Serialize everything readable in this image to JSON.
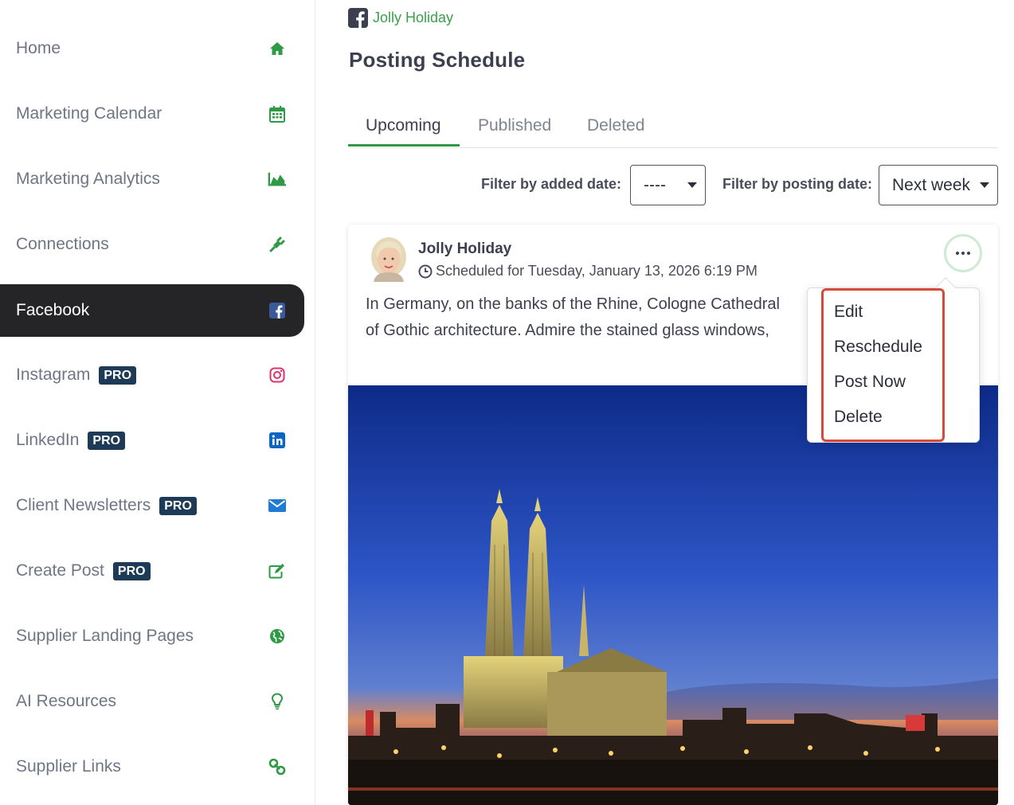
{
  "sidebar": {
    "items": [
      {
        "label": "Home",
        "icon": "home-icon",
        "pro": ""
      },
      {
        "label": "Marketing Calendar",
        "icon": "calendar-icon",
        "pro": ""
      },
      {
        "label": "Marketing Analytics",
        "icon": "area-chart-icon",
        "pro": ""
      },
      {
        "label": "Connections",
        "icon": "plug-icon",
        "pro": ""
      },
      {
        "label": "Facebook",
        "icon": "facebook-icon",
        "pro": ""
      },
      {
        "label": "Instagram",
        "icon": "instagram-icon",
        "pro": "PRO"
      },
      {
        "label": "LinkedIn",
        "icon": "linkedin-icon",
        "pro": "PRO"
      },
      {
        "label": "Client Newsletters",
        "icon": "envelope-icon",
        "pro": "PRO"
      },
      {
        "label": "Create Post",
        "icon": "edit-icon",
        "pro": "PRO"
      },
      {
        "label": "Supplier Landing Pages",
        "icon": "globe-icon",
        "pro": ""
      },
      {
        "label": "AI Resources",
        "icon": "lightbulb-icon",
        "pro": ""
      },
      {
        "label": "Supplier Links",
        "icon": "link-icon",
        "pro": ""
      }
    ],
    "active": "Facebook"
  },
  "header": {
    "breadcrumb": "Jolly Holiday",
    "title": "Posting Schedule"
  },
  "tabs": [
    {
      "label": "Upcoming",
      "active": true
    },
    {
      "label": "Published",
      "active": false
    },
    {
      "label": "Deleted",
      "active": false
    }
  ],
  "filters": {
    "added_label": "Filter by added date:",
    "added_value": "----",
    "posting_label": "Filter by posting date:",
    "posting_value": "Next week"
  },
  "post": {
    "author": "Jolly Holiday",
    "scheduled": "Scheduled for Tuesday, January 13, 2026 6:19 PM",
    "text_line1": "In Germany, on the banks of the Rhine, Cologne Cathedral",
    "text_line2": "of Gothic architecture. Admire the stained glass windows,"
  },
  "menu": {
    "items": [
      "Edit",
      "Reschedule",
      "Post Now",
      "Delete"
    ]
  },
  "colors": {
    "accent_green": "#2f9a45",
    "active_nav_bg": "#252528",
    "pro_badge": "#1d3a56",
    "highlight_red": "#d64a3a",
    "facebook_blue": "#3b5998"
  }
}
